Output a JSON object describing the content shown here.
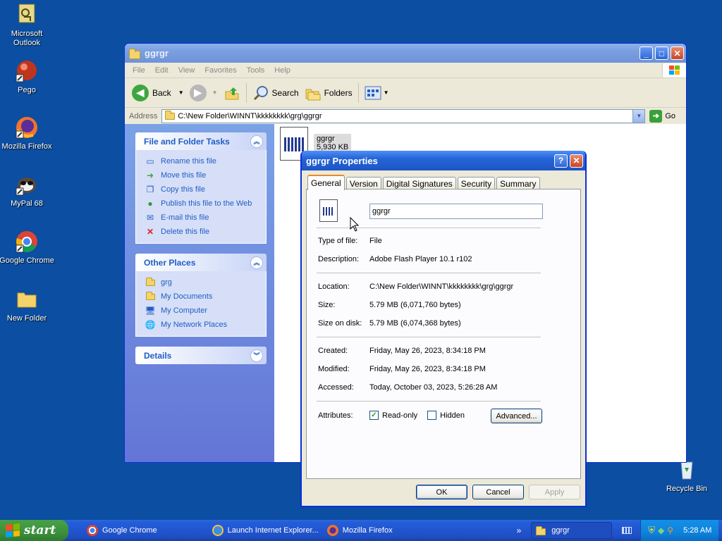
{
  "desktop": {
    "icons": [
      {
        "label_line1": "Microsoft",
        "label_line2": "Outlook",
        "icon": "outlook-icon"
      },
      {
        "label_line1": "Pego",
        "label_line2": "",
        "icon": "pego-icon"
      },
      {
        "label_line1": "Mozilla Firefox",
        "label_line2": "",
        "icon": "firefox-icon"
      },
      {
        "label_line1": "MyPal 68",
        "label_line2": "",
        "icon": "mypal-icon"
      },
      {
        "label_line1": "Google Chrome",
        "label_line2": "",
        "icon": "chrome-icon"
      },
      {
        "label_line1": "New Folder",
        "label_line2": "",
        "icon": "folder-icon"
      },
      {
        "label_line1": "Recycle Bin",
        "label_line2": "",
        "icon": "recycle-bin-icon"
      }
    ]
  },
  "explorer": {
    "title": "ggrgr",
    "menu": [
      "File",
      "Edit",
      "View",
      "Favorites",
      "Tools",
      "Help"
    ],
    "toolbar": {
      "back": "Back",
      "search": "Search",
      "folders": "Folders"
    },
    "address": {
      "label": "Address",
      "value": "C:\\New Folder\\WINNT\\kkkkkkkk\\grg\\ggrgr",
      "go": "Go"
    },
    "tasks": {
      "file_folder_title": "File and Folder Tasks",
      "file_folder_items": [
        "Rename this file",
        "Move this file",
        "Copy this file",
        "Publish this file to the Web",
        "E-mail this file",
        "Delete this file"
      ],
      "other_places_title": "Other Places",
      "other_places_items": [
        "grg",
        "My Documents",
        "My Computer",
        "My Network Places"
      ],
      "details_title": "Details"
    },
    "file": {
      "name": "ggrgr",
      "size": "5,930 KB"
    }
  },
  "dialog": {
    "title": "ggrgr Properties",
    "tabs": [
      "General",
      "Version",
      "Digital Signatures",
      "Security",
      "Summary"
    ],
    "name_value": "ggrgr",
    "type_label": "Type of file:",
    "type_value": "File",
    "desc_label": "Description:",
    "desc_value": "Adobe Flash Player 10.1 r102",
    "location_label": "Location:",
    "location_value": "C:\\New Folder\\WINNT\\kkkkkkkk\\grg\\ggrgr",
    "size_label": "Size:",
    "size_value": "5.79 MB (6,071,760 bytes)",
    "disk_label": "Size on disk:",
    "disk_value": "5.79 MB (6,074,368 bytes)",
    "created_label": "Created:",
    "created_value": "Friday, May 26, 2023, 8:34:18 PM",
    "modified_label": "Modified:",
    "modified_value": "Friday, May 26, 2023, 8:34:18 PM",
    "accessed_label": "Accessed:",
    "accessed_value": "Today, October 03, 2023, 5:26:28 AM",
    "attributes_label": "Attributes:",
    "readonly_label": "Read-only",
    "readonly_checked": true,
    "hidden_label": "Hidden",
    "hidden_checked": false,
    "advanced_label": "Advanced...",
    "ok_label": "OK",
    "cancel_label": "Cancel",
    "apply_label": "Apply"
  },
  "taskbar": {
    "start_label": "start",
    "items": [
      "Google Chrome",
      "Launch Internet Explorer...",
      "Mozilla Firefox",
      "ggrgr"
    ],
    "overflow": "»",
    "clock": "5:28 AM"
  }
}
